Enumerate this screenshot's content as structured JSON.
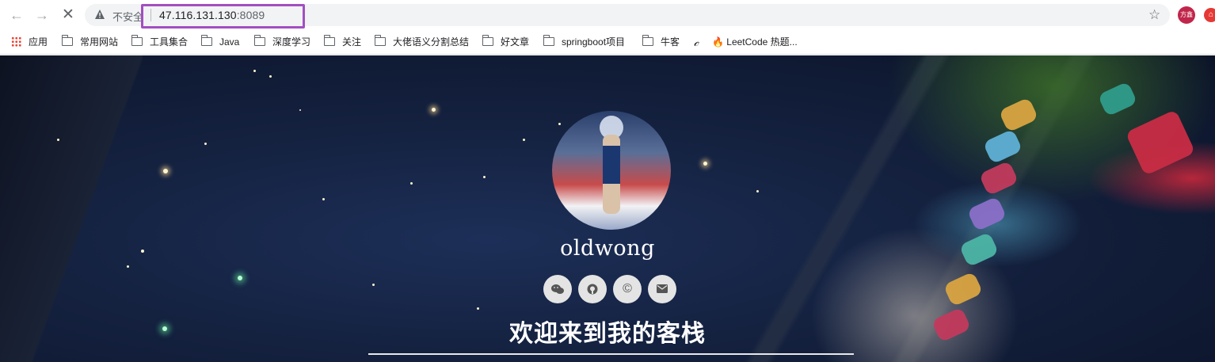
{
  "browser": {
    "security_label": "不安全",
    "url_host": "47.116.131.130",
    "url_port": ":8089",
    "profile_label": "方鑫"
  },
  "bookmarks": [
    {
      "label": "应用",
      "icon": "apps-grid-icon"
    },
    {
      "label": "常用网站",
      "icon": "folder-icon"
    },
    {
      "label": "工具集合",
      "icon": "folder-icon"
    },
    {
      "label": "Java",
      "icon": "folder-icon"
    },
    {
      "label": "深度学习",
      "icon": "folder-icon"
    },
    {
      "label": "关注",
      "icon": "folder-icon"
    },
    {
      "label": "大佬语义分割总结",
      "icon": "folder-icon"
    },
    {
      "label": "好文章",
      "icon": "folder-icon"
    },
    {
      "label": "springboot项目",
      "icon": "folder-icon"
    },
    {
      "label": "牛客",
      "icon": "folder-icon"
    },
    {
      "label": "",
      "icon": "cursive-c-icon"
    },
    {
      "label": "🔥 LeetCode 热题...",
      "icon": "fire-icon"
    }
  ],
  "hero": {
    "site_name": "oldwong",
    "welcome": "欢迎来到我的客栈",
    "social": [
      {
        "name": "wechat-icon",
        "glyph": "✉"
      },
      {
        "name": "github-icon",
        "glyph": "◉"
      },
      {
        "name": "copyright-icon",
        "glyph": "©"
      },
      {
        "name": "mail-icon",
        "glyph": "✉"
      }
    ]
  },
  "colors": {
    "url_highlight": "#a24fc1",
    "profile_bg": "#c0264a",
    "page_bg": "#14213f"
  }
}
